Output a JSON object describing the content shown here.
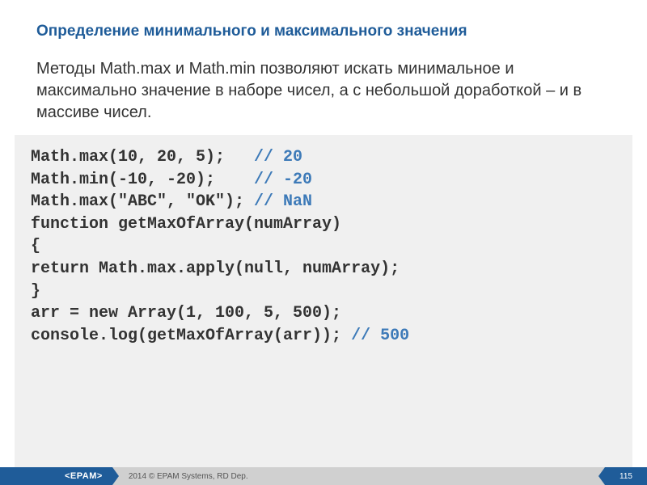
{
  "title": "Определение минимального и максимального значения",
  "description": "Методы Math.max и Math.min позволяют искать минимальное и максимально значение в наборе чисел, а с небольшой доработкой – и в массиве чисел.",
  "code": {
    "l1a": "Math.max(10, 20, 5);   ",
    "l1b": "// 20",
    "l2a": "Math.min(-10, -20);    ",
    "l2b": "// -20",
    "l3a": "Math.max(\"ABC\", \"OK\"); ",
    "l3b": "// NaN",
    "l4": "",
    "l5": "function getMaxOfArray(numArray)",
    "l6": "{",
    "l7": "return Math.max.apply(null, numArray);",
    "l8": "}",
    "l9": "",
    "l10": "arr = new Array(1, 100, 5, 500);",
    "l11a": "console.log(getMaxOfArray(arr)); ",
    "l11b": "// 500"
  },
  "footer": {
    "logo": "<EPAM>",
    "copy": "2014 © EPAM Systems, RD Dep.",
    "page": "115"
  }
}
